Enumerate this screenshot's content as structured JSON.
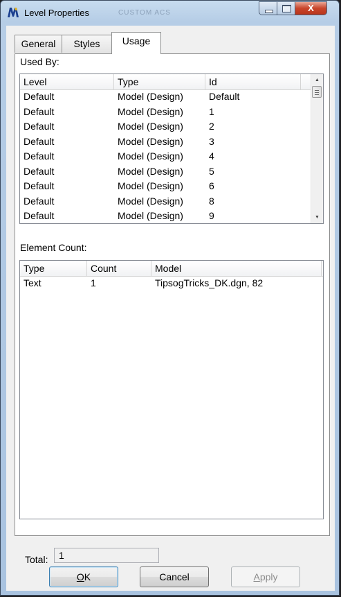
{
  "window": {
    "title": "Level Properties",
    "background_title": "CUSTOM ACS",
    "close_label": "X"
  },
  "tabs": [
    {
      "label": "General",
      "active": false
    },
    {
      "label": "Styles",
      "active": false
    },
    {
      "label": "Usage",
      "active": true
    }
  ],
  "used_by": {
    "label": "Used By:",
    "columns": [
      "Level",
      "Type",
      "Id"
    ],
    "rows": [
      [
        "Default",
        "Model (Design)",
        "Default"
      ],
      [
        "Default",
        "Model (Design)",
        "1"
      ],
      [
        "Default",
        "Model (Design)",
        "2"
      ],
      [
        "Default",
        "Model (Design)",
        "3"
      ],
      [
        "Default",
        "Model (Design)",
        "4"
      ],
      [
        "Default",
        "Model (Design)",
        "5"
      ],
      [
        "Default",
        "Model (Design)",
        "6"
      ],
      [
        "Default",
        "Model (Design)",
        "8"
      ],
      [
        "Default",
        "Model (Design)",
        "9"
      ]
    ]
  },
  "element_count": {
    "label": "Element Count:",
    "columns": [
      "Type",
      "Count",
      "Model"
    ],
    "rows": [
      [
        "Text",
        "1",
        "TipsogTricks_DK.dgn, 82"
      ]
    ]
  },
  "total": {
    "label": "Total:",
    "value": "1"
  },
  "buttons": {
    "ok": {
      "mnemonic": "O",
      "rest": "K"
    },
    "cancel": "Cancel",
    "apply": {
      "mnemonic": "A",
      "rest": "pply"
    }
  },
  "colors": {
    "title_bar": "#b6cde6",
    "close_button": "#c8452b",
    "dialog_face": "#f0f0f0",
    "default_button_border": "#3c7fb1"
  },
  "icons": {
    "app": "microstation-logo-icon",
    "minimize": "minimize-icon",
    "maximize": "maximize-icon",
    "close": "close-icon"
  }
}
